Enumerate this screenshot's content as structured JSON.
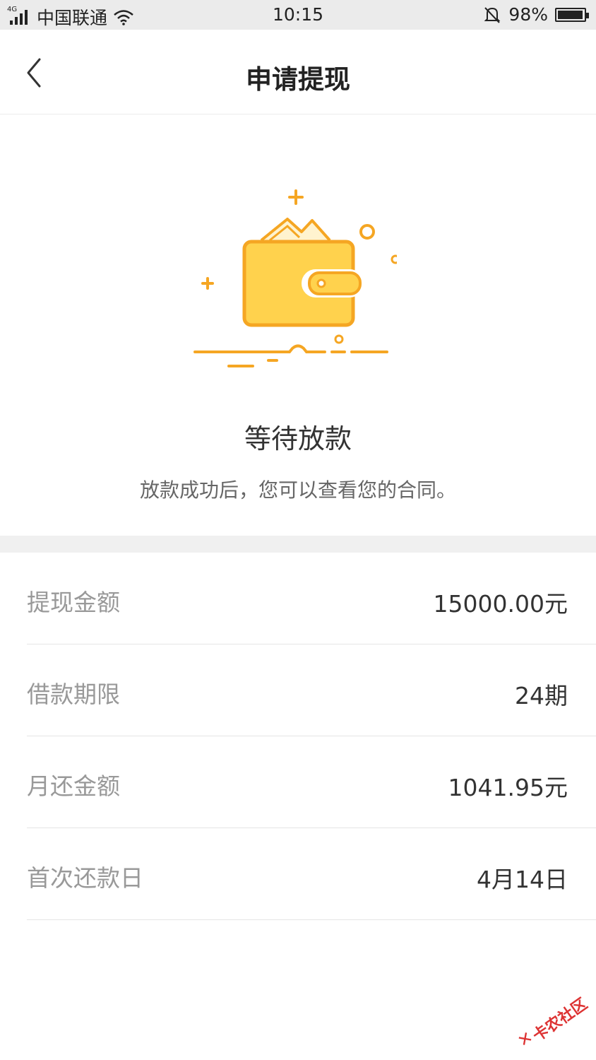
{
  "status_bar": {
    "network_tag": "4G",
    "carrier": "中国联通",
    "time": "10:15",
    "battery": "98%",
    "icons": [
      "signal-icon",
      "wifi-icon",
      "mute-bell-icon",
      "battery-icon"
    ]
  },
  "nav": {
    "title": "申请提现",
    "back_icon": "chevron-left-icon"
  },
  "status": {
    "title": "等待放款",
    "description": "放款成功后，您可以查看您的合同。",
    "illustration": "wallet-icon",
    "accent_color": "#f5a623",
    "wallet_color": "#ffd24d"
  },
  "details": [
    {
      "label": "提现金额",
      "value": "15000.00元"
    },
    {
      "label": "借款期限",
      "value": "24期"
    },
    {
      "label": "月还金额",
      "value": "1041.95元"
    },
    {
      "label": "首次还款日",
      "value": "4月14日"
    }
  ],
  "watermark": {
    "text": "卡农社区"
  }
}
